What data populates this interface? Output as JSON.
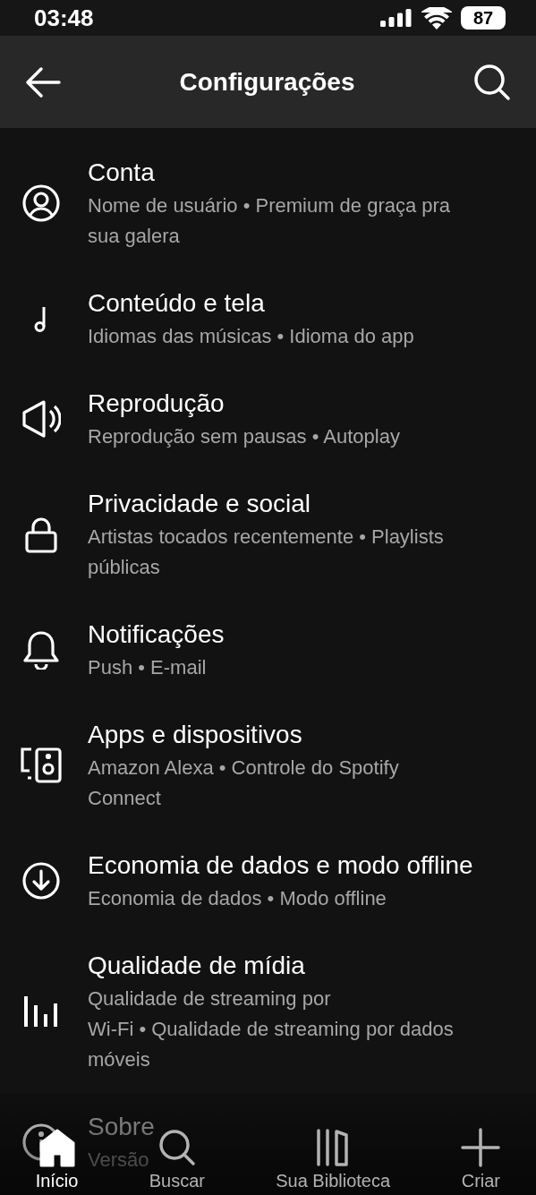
{
  "status_bar": {
    "time": "03:48",
    "battery": "87"
  },
  "header": {
    "title": "Configurações"
  },
  "settings": [
    {
      "title": "Conta",
      "subtitle_lines": [
        "Nome de usuário • Premium de graça pra",
        "sua galera"
      ]
    },
    {
      "title": "Conteúdo e tela",
      "subtitle_lines": [
        "Idiomas das músicas • Idioma do app"
      ]
    },
    {
      "title": "Reprodução",
      "subtitle_lines": [
        "Reprodução sem pausas • Autoplay"
      ]
    },
    {
      "title": "Privacidade e social",
      "subtitle_lines": [
        "Artistas tocados recentemente • Playlists",
        "públicas"
      ]
    },
    {
      "title": "Notificações",
      "subtitle_lines": [
        "Push • E-mail"
      ]
    },
    {
      "title": "Apps e dispositivos",
      "subtitle_lines": [
        "Amazon Alexa • Controle do Spotify",
        "Connect"
      ]
    },
    {
      "title": "Economia de dados e modo offline",
      "subtitle_lines": [
        "Economia de dados • Modo offline"
      ]
    },
    {
      "title": "Qualidade de mídia",
      "subtitle_lines": [
        "Qualidade de streaming por",
        "Wi-Fi • Qualidade de streaming por dados",
        "móveis"
      ]
    },
    {
      "title": "Sobre",
      "subtitle_lines": [
        "Versão"
      ]
    }
  ],
  "nav": [
    {
      "label": "Início",
      "selected": true
    },
    {
      "label": "Buscar",
      "selected": false
    },
    {
      "label": "Sua Biblioteca",
      "selected": false
    },
    {
      "label": "Criar",
      "selected": false
    }
  ]
}
